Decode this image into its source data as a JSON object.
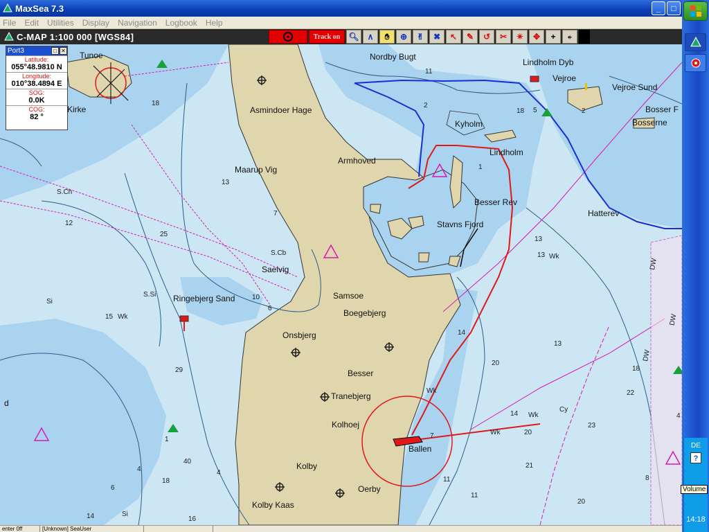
{
  "window": {
    "title": "MaxSea 7.3",
    "btn_min": "_",
    "btn_max": "□",
    "btn_close": "×"
  },
  "menu": [
    "File",
    "Edit",
    "Utilities",
    "Display",
    "Navigation",
    "Logbook",
    "Help"
  ],
  "chart_header": {
    "title": "C-MAP  1:100 000 [WGS84]",
    "track_label": "Track on"
  },
  "toolbar_icons": [
    "target-icon",
    "track-on-button",
    "zoom-icon",
    "compass-icon",
    "hand-pan-icon",
    "crosshair-icon",
    "grab-icon",
    "route-icon",
    "pointer-icon",
    "pencil-icon",
    "rotate-icon",
    "scissors-icon",
    "mark-icon",
    "move-icon",
    "plus-icon",
    "lighthouse-icon"
  ],
  "port_panel": {
    "title": "Port3",
    "latitude_label": "Latitude:",
    "latitude": "055°48.9810 N",
    "longitude_label": "Longitude:",
    "longitude": "010°38.4894 E",
    "sog_label": "SOG:",
    "sog": "0.0K",
    "cog_label": "COG:",
    "cog": "82 °"
  },
  "map_labels": {
    "tunoe": "Tunoe",
    "kirke": "Kirke",
    "nordby_bugt": "Nordby Bugt",
    "lindholm_dyb": "Lindholm Dyb",
    "vejroe": "Vejroe",
    "vejroe_sund": "Vejroe Sund",
    "bosser_f": "Bosser F",
    "bosserne": "Bosserne",
    "asmindoer_hage": "Asmindoer Hage",
    "kyholm": "Kyholm",
    "lindholm": "Lindholm",
    "armhoved": "Armhoved",
    "maarup_vig": "Maarup Vig",
    "besser_rev": "Besser Rev",
    "stavns_fjord": "Stavns Fjord",
    "hatterev": "Hatterev",
    "saelvig": "Saelvig",
    "ringebjerg_sand": "Ringebjerg Sand",
    "samsoe": "Samsoe",
    "boegebjerg": "Boegebjerg",
    "onsbjerg": "Onsbjerg",
    "besser": "Besser",
    "tranebjerg": "Tranebjerg",
    "kolhoej": "Kolhoej",
    "ballen": "Ballen",
    "kolby": "Kolby",
    "oerby": "Oerby",
    "kolby_kaas": "Kolby Kaas",
    "scb": "S.Cb",
    "sch": "S.Ch",
    "ssi": "S.Si",
    "si1": "Si",
    "si2": "Si",
    "wk1": "Wk",
    "wk2": "Wk",
    "wk3": "Wk",
    "wk4": "Wk",
    "wk5": "Wk",
    "cy": "Cy",
    "dw1": "DW",
    "dw2": "DW",
    "dw3": "DW",
    "d": "d"
  },
  "soundings": [
    "11",
    "18",
    "2",
    "5",
    "1",
    "18",
    "13",
    "7",
    "12",
    "25",
    "10",
    "6",
    "15",
    "29",
    "13",
    "14",
    "13",
    "20",
    "18",
    "23",
    "21",
    "14",
    "11",
    "11",
    "40",
    "18",
    "4",
    "6",
    "14",
    "16",
    "7",
    "20",
    "22",
    "8",
    "20",
    "13",
    "4",
    "1",
    "4",
    "2"
  ],
  "status": [
    "enter 0ff",
    "[Unknown] SeaUser"
  ],
  "taskbar": {
    "lang": "DE",
    "help": "?",
    "clock": "14:18",
    "volume_tip": "Volume"
  }
}
